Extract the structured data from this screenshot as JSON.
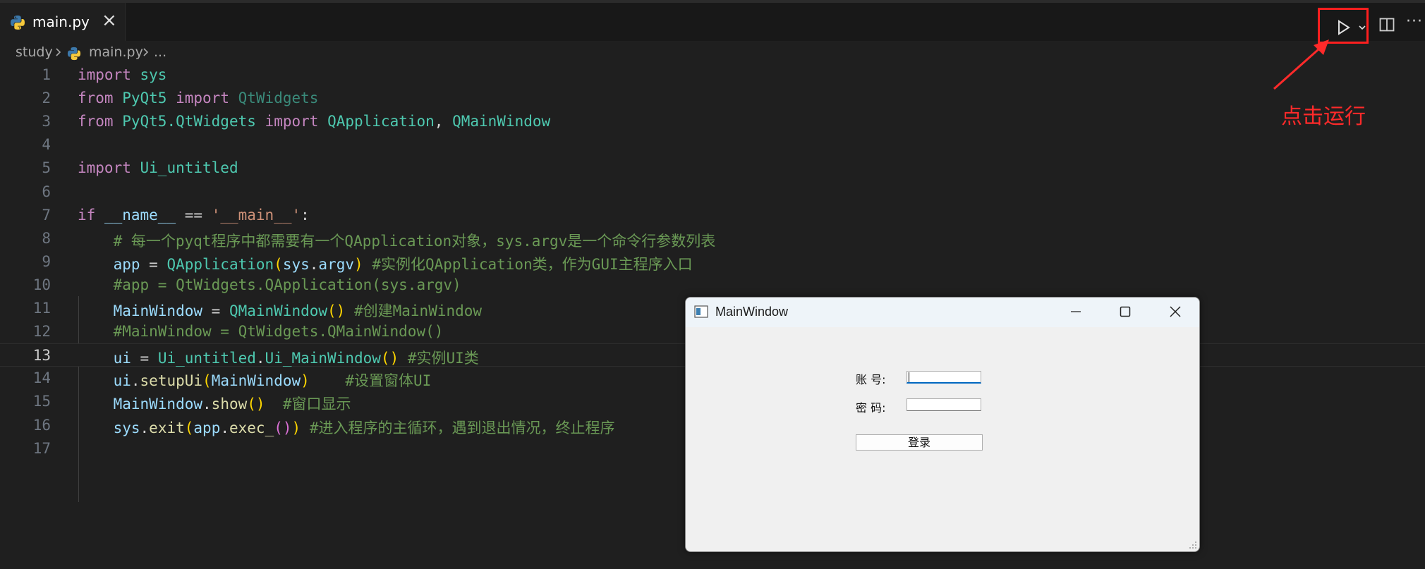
{
  "tab": {
    "label": "main.py",
    "close": "×"
  },
  "breadcrumb": {
    "folder": "study",
    "file": "main.py",
    "ellipsis": "..."
  },
  "actions": {
    "more": "···"
  },
  "annotation": {
    "text": "点击运行",
    "color": "#ff2a2a"
  },
  "code_lines": [
    {
      "n": "1",
      "parts": [
        [
          "kw",
          "import"
        ],
        [
          "op",
          " "
        ],
        [
          "mod",
          "sys"
        ]
      ]
    },
    {
      "n": "2",
      "parts": [
        [
          "kw",
          "from"
        ],
        [
          "op",
          " "
        ],
        [
          "mod",
          "PyQt5"
        ],
        [
          "op",
          " "
        ],
        [
          "kw",
          "import"
        ],
        [
          "op",
          " "
        ],
        [
          "dim",
          "QtWidgets"
        ]
      ]
    },
    {
      "n": "3",
      "parts": [
        [
          "kw",
          "from"
        ],
        [
          "op",
          " "
        ],
        [
          "mod",
          "PyQt5.QtWidgets"
        ],
        [
          "op",
          " "
        ],
        [
          "kw",
          "import"
        ],
        [
          "op",
          " "
        ],
        [
          "cls",
          "QApplication"
        ],
        [
          "op",
          ", "
        ],
        [
          "cls",
          "QMainWindow"
        ]
      ]
    },
    {
      "n": "4",
      "parts": []
    },
    {
      "n": "5",
      "parts": [
        [
          "kw",
          "import"
        ],
        [
          "op",
          " "
        ],
        [
          "mod",
          "Ui_untitled"
        ]
      ]
    },
    {
      "n": "6",
      "parts": []
    },
    {
      "n": "7",
      "parts": [
        [
          "kw",
          "if"
        ],
        [
          "op",
          " "
        ],
        [
          "var",
          "__name__"
        ],
        [
          "op",
          " == "
        ],
        [
          "str",
          "'__main__'"
        ],
        [
          "op",
          ":"
        ]
      ]
    },
    {
      "n": "8",
      "parts": [
        [
          "op",
          "    "
        ],
        [
          "cmt",
          "# 每一个pyqt程序中都需要有一个QApplication对象，sys.argv是一个命令行参数列表"
        ]
      ]
    },
    {
      "n": "9",
      "parts": [
        [
          "op",
          "    "
        ],
        [
          "var",
          "app"
        ],
        [
          "op",
          " = "
        ],
        [
          "cls",
          "QApplication"
        ],
        [
          "br1",
          "("
        ],
        [
          "var",
          "sys"
        ],
        [
          "op",
          "."
        ],
        [
          "var",
          "argv"
        ],
        [
          "br1",
          ")"
        ],
        [
          "op",
          " "
        ],
        [
          "cmt",
          "#实例化QApplication类，作为GUI主程序入口"
        ]
      ]
    },
    {
      "n": "10",
      "parts": [
        [
          "op",
          "    "
        ],
        [
          "cmt",
          "#app = QtWidgets.QApplication(sys.argv)"
        ]
      ]
    },
    {
      "n": "11",
      "parts": [
        [
          "op",
          "    "
        ],
        [
          "var",
          "MainWindow"
        ],
        [
          "op",
          " = "
        ],
        [
          "cls",
          "QMainWindow"
        ],
        [
          "br1",
          "()"
        ],
        [
          "op",
          " "
        ],
        [
          "cmt",
          "#创建MainWindow"
        ]
      ]
    },
    {
      "n": "12",
      "parts": [
        [
          "op",
          "    "
        ],
        [
          "cmt",
          "#MainWindow = QtWidgets.QMainWindow()"
        ]
      ]
    },
    {
      "n": "13",
      "parts": [
        [
          "op",
          "    "
        ],
        [
          "var",
          "ui"
        ],
        [
          "op",
          " = "
        ],
        [
          "mod",
          "Ui_untitled"
        ],
        [
          "op",
          "."
        ],
        [
          "cls",
          "Ui_MainWindow"
        ],
        [
          "br1",
          "()"
        ],
        [
          "op",
          " "
        ],
        [
          "cmt",
          "#实例UI类"
        ]
      ]
    },
    {
      "n": "14",
      "parts": [
        [
          "op",
          "    "
        ],
        [
          "var",
          "ui"
        ],
        [
          "op",
          "."
        ],
        [
          "fn",
          "setupUi"
        ],
        [
          "br1",
          "("
        ],
        [
          "var",
          "MainWindow"
        ],
        [
          "br1",
          ")"
        ],
        [
          "op",
          "    "
        ],
        [
          "cmt",
          "#设置窗体UI"
        ]
      ]
    },
    {
      "n": "15",
      "parts": [
        [
          "op",
          "    "
        ],
        [
          "var",
          "MainWindow"
        ],
        [
          "op",
          "."
        ],
        [
          "fn",
          "show"
        ],
        [
          "br1",
          "()"
        ],
        [
          "op",
          "  "
        ],
        [
          "cmt",
          "#窗口显示"
        ]
      ]
    },
    {
      "n": "16",
      "parts": [
        [
          "op",
          "    "
        ],
        [
          "var",
          "sys"
        ],
        [
          "op",
          "."
        ],
        [
          "fn",
          "exit"
        ],
        [
          "br1",
          "("
        ],
        [
          "var",
          "app"
        ],
        [
          "op",
          "."
        ],
        [
          "fn",
          "exec_"
        ],
        [
          "br2",
          "()"
        ],
        [
          "br1",
          ")"
        ],
        [
          "op",
          " "
        ],
        [
          "cmt",
          "#进入程序的主循环，遇到退出情况，终止程序"
        ]
      ]
    },
    {
      "n": "17",
      "parts": []
    }
  ],
  "qt_window": {
    "title": "MainWindow",
    "account_label": "账  号:",
    "password_label": "密  码:",
    "login_button": "登录"
  }
}
